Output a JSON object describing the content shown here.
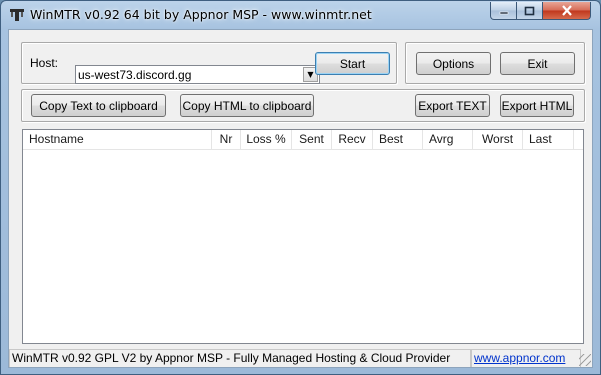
{
  "window": {
    "title": "WinMTR v0.92 64 bit by Appnor MSP - www.winmtr.net",
    "controls": {
      "minimize_icon": "minimize-icon",
      "maximize_icon": "maximize-icon",
      "close_icon": "close-icon"
    }
  },
  "host": {
    "label": "Host:",
    "value": "us-west73.discord.gg"
  },
  "buttons": {
    "start": "Start",
    "options": "Options",
    "exit": "Exit",
    "copy_text": "Copy Text to clipboard",
    "copy_html": "Copy HTML to clipboard",
    "export_text": "Export TEXT",
    "export_html": "Export HTML"
  },
  "table": {
    "columns": [
      "Hostname",
      "Nr",
      "Loss %",
      "Sent",
      "Recv",
      "Best",
      "Avrg",
      "Worst",
      "Last"
    ],
    "rows": []
  },
  "status": {
    "text": "WinMTR v0.92 GPL V2 by Appnor MSP - Fully Managed Hosting & Cloud Provider",
    "link": "www.appnor.com"
  },
  "colors": {
    "link": "#0033cc",
    "close_button": "#c0361c"
  }
}
